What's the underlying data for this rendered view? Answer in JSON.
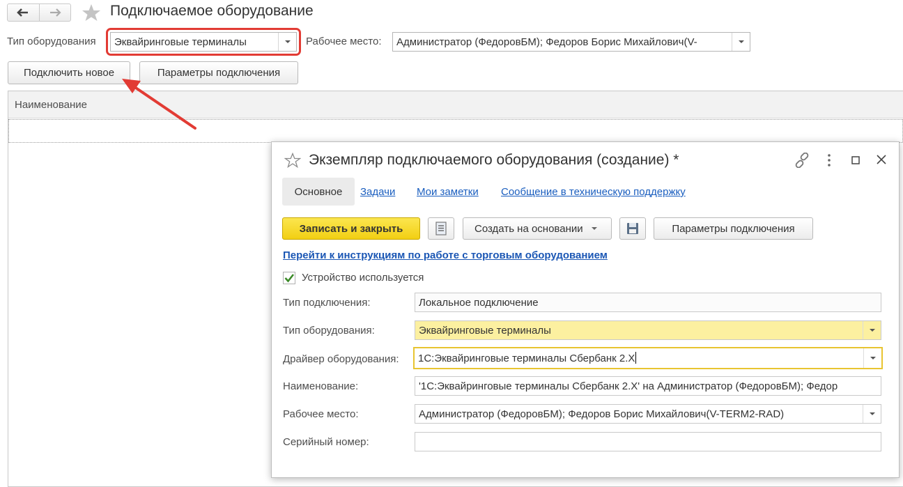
{
  "main": {
    "title": "Подключаемое оборудование",
    "equipment_type_label": "Тип оборудования",
    "equipment_type_value": "Эквайринговые терминалы",
    "workplace_label": "Рабочее место:",
    "workplace_value": "Администратор (ФедоровБМ); Федоров Борис Михайлович(V-",
    "connect_new_label": "Подключить новое",
    "connection_params_label": "Параметры подключения",
    "grid_column_name": "Наименование"
  },
  "dialog": {
    "title": "Экземпляр подключаемого оборудования (создание) *",
    "tabs": [
      "Основное",
      "Задачи",
      "Мои заметки",
      "Сообщение в техническую поддержку"
    ],
    "save_close_label": "Записать и закрыть",
    "create_based_label": "Создать на основании",
    "connection_params_label": "Параметры подключения",
    "instructions_link": "Перейти к инструкциям по работе с торговым оборудованием",
    "device_used_label": "Устройство используется",
    "device_used_checked": true,
    "fields": {
      "connection_type": {
        "label": "Тип подключения:",
        "value": "Локальное подключение"
      },
      "equipment_type": {
        "label": "Тип оборудования:",
        "value": "Эквайринговые терминалы"
      },
      "driver": {
        "label": "Драйвер оборудования:",
        "value": "1С:Эквайринговые терминалы Сбербанк 2.X"
      },
      "name": {
        "label": "Наименование:",
        "value": "'1С:Эквайринговые терминалы Сбербанк 2.X' на Администратор (ФедоровБМ); Федор"
      },
      "workplace": {
        "label": "Рабочее место:",
        "value": "Администратор (ФедоровБМ); Федоров Борис Михайлович(V-TERM2-RAD)"
      },
      "serial": {
        "label": "Серийный номер:",
        "value": ""
      }
    }
  },
  "colors": {
    "highlight_frame": "#e23b34",
    "annotation_arrow": "#e23b34",
    "primary_button": "#f7dc2e",
    "link": "#1a5ebf"
  }
}
